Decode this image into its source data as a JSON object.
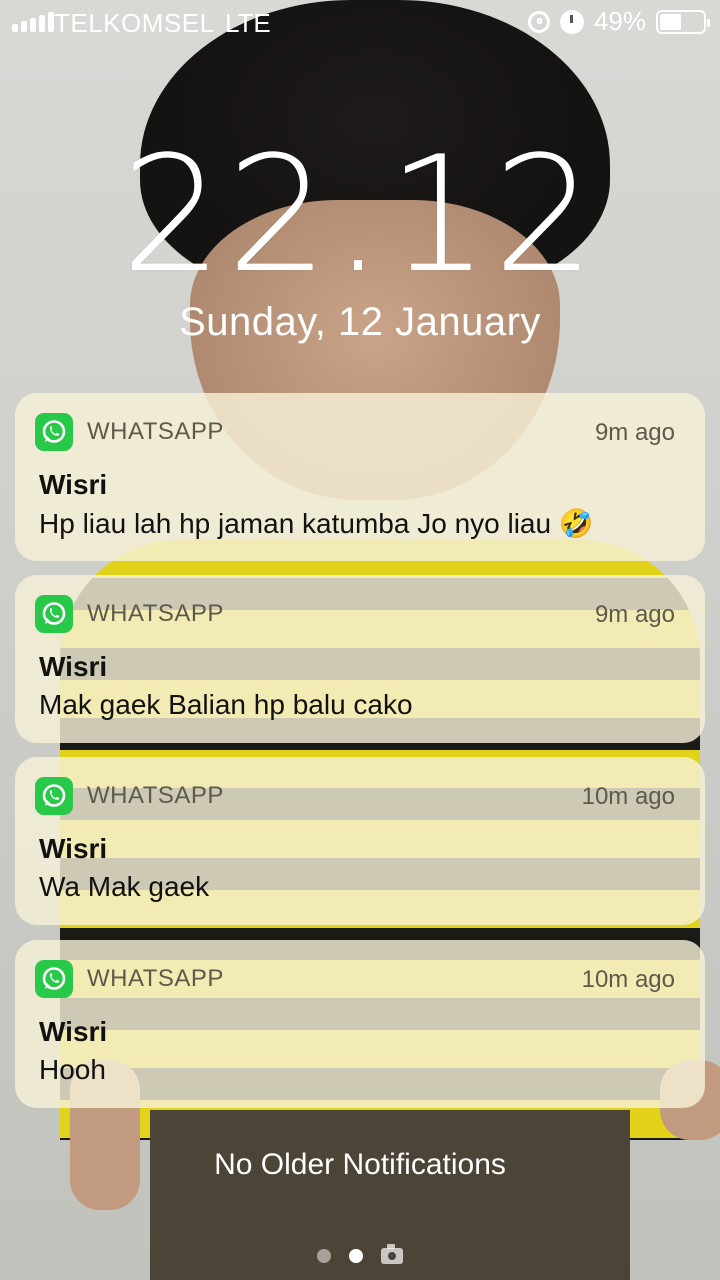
{
  "status_bar": {
    "carrier": "TELKOMSEL",
    "network": "LTE",
    "battery": "49%",
    "battery_level": 0.49,
    "icons": [
      "signal-icon",
      "rotation-lock-icon",
      "alarm-icon",
      "battery-icon"
    ]
  },
  "lock_screen": {
    "time": "22.12",
    "date": "Sunday, 12 January"
  },
  "notifications": [
    {
      "app": "WHATSAPP",
      "time": "9m ago",
      "sender": "Wisri",
      "message": "Hp liau lah hp jaman katumba Jo nyo liau 🤣"
    },
    {
      "app": "WHATSAPP",
      "time": "9m ago",
      "sender": "Wisri",
      "message": "Mak gaek Balian hp balu cako"
    },
    {
      "app": "WHATSAPP",
      "time": "10m ago",
      "sender": "Wisri",
      "message": "Wa Mak gaek"
    },
    {
      "app": "WHATSAPP",
      "time": "10m ago",
      "sender": "Wisri",
      "message": "Hooh"
    }
  ],
  "footer": {
    "no_older": "No Older Notifications"
  },
  "colors": {
    "whatsapp_green": "#28c949",
    "card_background": "#f6f0d7"
  }
}
